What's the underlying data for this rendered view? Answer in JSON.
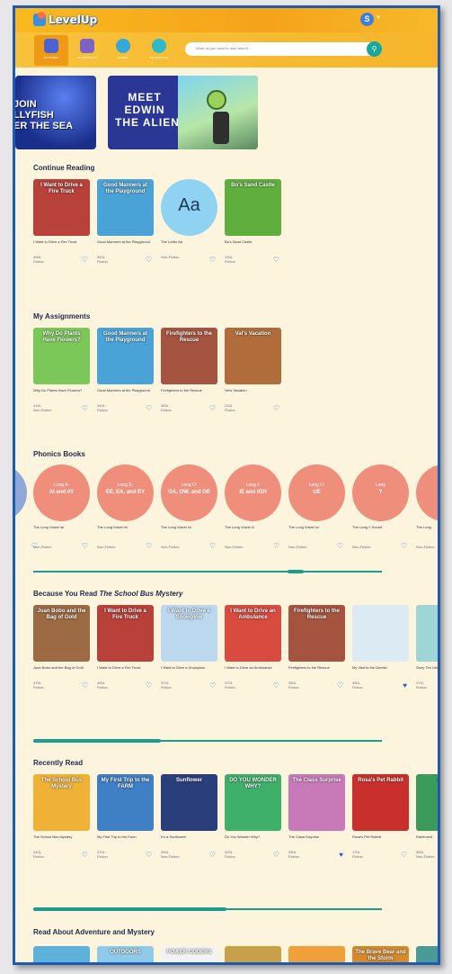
{
  "header": {
    "logo_text": "LevelUp",
    "avatar_initial": "S"
  },
  "nav": {
    "items": [
      {
        "label": "MY BOOKS",
        "color": "#4a62d6",
        "active": true
      },
      {
        "label": "MY PROGRESS",
        "color": "#7d63c9",
        "active": false
      },
      {
        "label": "BADGES",
        "color": "#35a7d8",
        "active": false
      },
      {
        "label": "READING LOG",
        "color": "#2fb8c8",
        "active": false
      }
    ]
  },
  "search": {
    "placeholder": "What do you want to read about?"
  },
  "banners": {
    "jellyfish": "JOIN\nLLYFISH\nER THE SEA",
    "edwin": "MEET\nEDWIN\nTHE ALIEN"
  },
  "sections": {
    "continue": {
      "title": "Continue Reading",
      "books": [
        {
          "title": "I Want to Drive a Fire Truck",
          "cover": "I Want to Drive a Fire Truck",
          "level": "400L",
          "genre": "Fiction",
          "color": "#b8413a"
        },
        {
          "title": "Good Manners at the Playground",
          "cover": "Good Manners at the Playground",
          "level": "340L",
          "genre": "Fiction",
          "color": "#4aa3d6"
        },
        {
          "title": "The Letter Aa",
          "cover": "Aa",
          "level": "",
          "genre": "Non-Fiction",
          "color": "#8fd2f2"
        },
        {
          "title": "Bo's Sand Castle",
          "cover": "Bo's Sand Castle",
          "level": "130L",
          "genre": "Fiction",
          "color": "#5fae3e"
        }
      ]
    },
    "assignments": {
      "title": "My Assignments",
      "books": [
        {
          "title": "Why Do Plants Have Flowers?",
          "cover": "Why Do Plants Have Flowers?",
          "level": "410L",
          "genre": "Non-Fiction",
          "color": "#7cc75a"
        },
        {
          "title": "Good Manners at the Playground",
          "cover": "Good Manners at the Playground",
          "level": "340L",
          "genre": "Fiction",
          "color": "#4aa3d6"
        },
        {
          "title": "Firefighters to the Rescue",
          "cover": "Firefighters to the Rescue",
          "level": "350L",
          "genre": "Fiction",
          "color": "#a5553f"
        },
        {
          "title": "Val's Vacation",
          "cover": "Val's Vacation",
          "level": "210L",
          "genre": "Fiction",
          "color": "#b06d3b"
        }
      ]
    },
    "phonics": {
      "title": "Phonics Books",
      "prefix_partial": "a",
      "books": [
        {
          "title": "The Long Vowel /a/",
          "circle_top": "Long A:",
          "circle_main": "AI and AY",
          "genre": "Non-Fiction"
        },
        {
          "title": "The Long Vowel /e/",
          "circle_top": "Long E:",
          "circle_main": "EE, EA, and EY",
          "genre": "Non-Fiction"
        },
        {
          "title": "The Long Vowel /o/",
          "circle_top": "Long O:",
          "circle_main": "OA, OW, and OE",
          "genre": "Non-Fiction"
        },
        {
          "title": "The Long Vowel /i/",
          "circle_top": "Long I:",
          "circle_main": "IE and IGH",
          "genre": "Non-Fiction"
        },
        {
          "title": "The Long Vowel /u/",
          "circle_top": "Long U:",
          "circle_main": "UE",
          "genre": "Non-Fiction"
        },
        {
          "title": "The Long Y Sound",
          "circle_top": "Long",
          "circle_main": "Y",
          "genre": "Non-Fiction"
        },
        {
          "title": "The Long",
          "circle_top": "",
          "circle_main": "",
          "genre": "Non-Fiction"
        }
      ],
      "scroll_position": 0.75
    },
    "because": {
      "title_prefix": "Because You Read ",
      "title_book": "The School Bus Mystery",
      "books": [
        {
          "title": "Juan Bobo and the Bag of Gold",
          "cover": "Juan Bobo and the Bag of Gold",
          "level": "470L",
          "genre": "Fiction",
          "color": "#9c6b43",
          "fav": false
        },
        {
          "title": "I Want to Drive a Fire Truck",
          "cover": "I Want to Drive a Fire Truck",
          "level": "400L",
          "genre": "Fiction",
          "color": "#b8413a",
          "fav": false
        },
        {
          "title": "I Want to Drive a Snowplow",
          "cover": "I Want to Drive a Snowplow",
          "level": "370L",
          "genre": "Fiction",
          "color": "#bcd8ee",
          "fav": false
        },
        {
          "title": "I Want to Drive an Ambulance",
          "cover": "I Want to Drive an Ambulance",
          "level": "370L",
          "genre": "Fiction",
          "color": "#d94a3f",
          "fav": false
        },
        {
          "title": "Firefighters to the Rescue",
          "cover": "Firefighters to the Rescue",
          "level": "350L",
          "genre": "Fiction",
          "color": "#a5553f",
          "fav": false
        },
        {
          "title": "My Visit to the Dentist",
          "cover": "",
          "level": "350L",
          "genre": "Fiction",
          "color": "#dceaf4",
          "fav": true
        },
        {
          "title": "Story Tim Librarian",
          "cover": "",
          "level": "370L",
          "genre": "Fiction",
          "color": "#9ed6d8",
          "fav": false
        }
      ],
      "scroll_position": 0.0
    },
    "recent": {
      "title": "Recently Read",
      "books": [
        {
          "title": "The School Bus Mystery",
          "cover": "The School Bus Mystery",
          "level": "240L",
          "genre": "Fiction",
          "color": "#f0b236",
          "fav": false
        },
        {
          "title": "My First Trip to the Farm",
          "cover": "My First Trip to the FARM",
          "level": "370L",
          "genre": "Fiction",
          "color": "#3f7fc6",
          "fav": false
        },
        {
          "title": "It's a Sunflower!",
          "cover": "Sunflower",
          "level": "390L",
          "genre": "Non-Fiction",
          "color": "#2b3e7c",
          "fav": false
        },
        {
          "title": "Do You Wonder Why?",
          "cover": "DO YOU WONDER WHY?",
          "level": "320L",
          "genre": "Fiction",
          "color": "#3fb06a",
          "fav": false
        },
        {
          "title": "The Class Surprise",
          "cover": "The Class Surprise",
          "level": "280L",
          "genre": "Fiction",
          "color": "#c87ab8",
          "fav": true
        },
        {
          "title": "Rosa's Pet Rabbit",
          "cover": "Rosa's Pet Rabbit",
          "level": "170L",
          "genre": "Fiction",
          "color": "#c9302c",
          "fav": false
        },
        {
          "title": "Rainforest",
          "cover": "RAIN",
          "level": "350L",
          "genre": "Non-Fiction",
          "color": "#3a9b5a",
          "fav": false
        }
      ],
      "scroll_position": 0.0
    },
    "adventure": {
      "title": "Read About Adventure and Mystery",
      "books": [
        {
          "cover": "",
          "color": "#5db2dc"
        },
        {
          "cover": "OUTDOORS",
          "color": "#8fcbe8"
        },
        {
          "cover": "POWER CODERS",
          "color": "#f3f3f6"
        },
        {
          "cover": "",
          "color": "#c8a04a"
        },
        {
          "cover": "",
          "color": "#f0a03a"
        },
        {
          "cover": "The Brave Bear and the Storm",
          "color": "#d48a2b"
        },
        {
          "cover": "",
          "color": "#4a9a9a"
        }
      ]
    }
  }
}
